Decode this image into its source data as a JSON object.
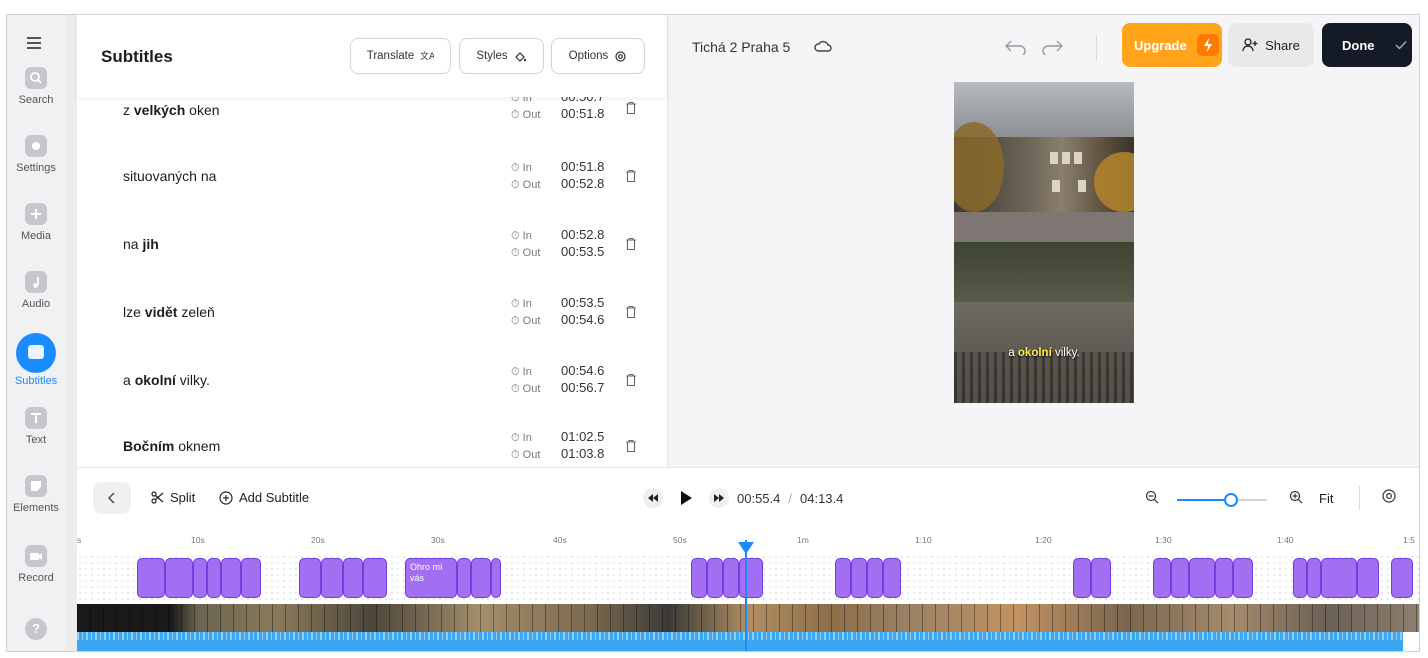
{
  "sidebar": {
    "items": [
      {
        "label": "Search",
        "icon": "search-icon"
      },
      {
        "label": "Settings",
        "icon": "gear-icon"
      },
      {
        "label": "Media",
        "icon": "plus-icon"
      },
      {
        "label": "Audio",
        "icon": "music-note-icon"
      },
      {
        "label": "Subtitles",
        "icon": "subtitles-icon",
        "active": true
      },
      {
        "label": "Text",
        "icon": "text-icon"
      },
      {
        "label": "Elements",
        "icon": "shapes-icon"
      },
      {
        "label": "Record",
        "icon": "camera-icon"
      }
    ],
    "help_label": "?"
  },
  "subtitles_panel": {
    "title": "Subtitles",
    "translate_label": "Translate",
    "styles_label": "Styles",
    "options_label": "Options",
    "in_label": "In",
    "out_label": "Out",
    "rows": [
      {
        "pre": "z ",
        "bold": "velkých",
        "post": " oken",
        "in": "00:50.7",
        "out": "00:51.8"
      },
      {
        "pre": "situovaných na",
        "bold": "",
        "post": "",
        "in": "00:51.8",
        "out": "00:52.8"
      },
      {
        "pre": "na ",
        "bold": "jih",
        "post": "",
        "in": "00:52.8",
        "out": "00:53.5"
      },
      {
        "pre": "lze ",
        "bold": "vidět",
        "post": " zeleň",
        "in": "00:53.5",
        "out": "00:54.6"
      },
      {
        "pre": "a ",
        "bold": "okolní",
        "post": " vilky.",
        "in": "00:54.6",
        "out": "00:56.7"
      },
      {
        "pre": "",
        "bold": "Bočním",
        "post": " oknem",
        "in": "01:02.5",
        "out": "01:03.8"
      }
    ]
  },
  "header": {
    "project_title": "Tichá 2 Praha 5",
    "upgrade_label": "Upgrade",
    "share_label": "Share",
    "done_label": "Done"
  },
  "video": {
    "caption_pre": "a ",
    "caption_highlight": "okolní",
    "caption_post": " vilky."
  },
  "timeline": {
    "split_label": "Split",
    "add_subtitle_label": "Add Subtitle",
    "current_time": "00:55.4",
    "separator": "/",
    "total_time": "04:13.4",
    "fit_label": "Fit",
    "zoom_level": 0.6,
    "ruler_labels": [
      "s",
      "10s",
      "20s",
      "30s",
      "40s",
      "50s",
      "1m",
      "1:10",
      "1:20",
      "1:30",
      "1:40",
      "1:5"
    ],
    "clip_text": "Ohro mí vás",
    "colors": {
      "clip": "#a26ef2",
      "accent": "#1a8cff",
      "upgrade": "#ffa41b"
    }
  }
}
